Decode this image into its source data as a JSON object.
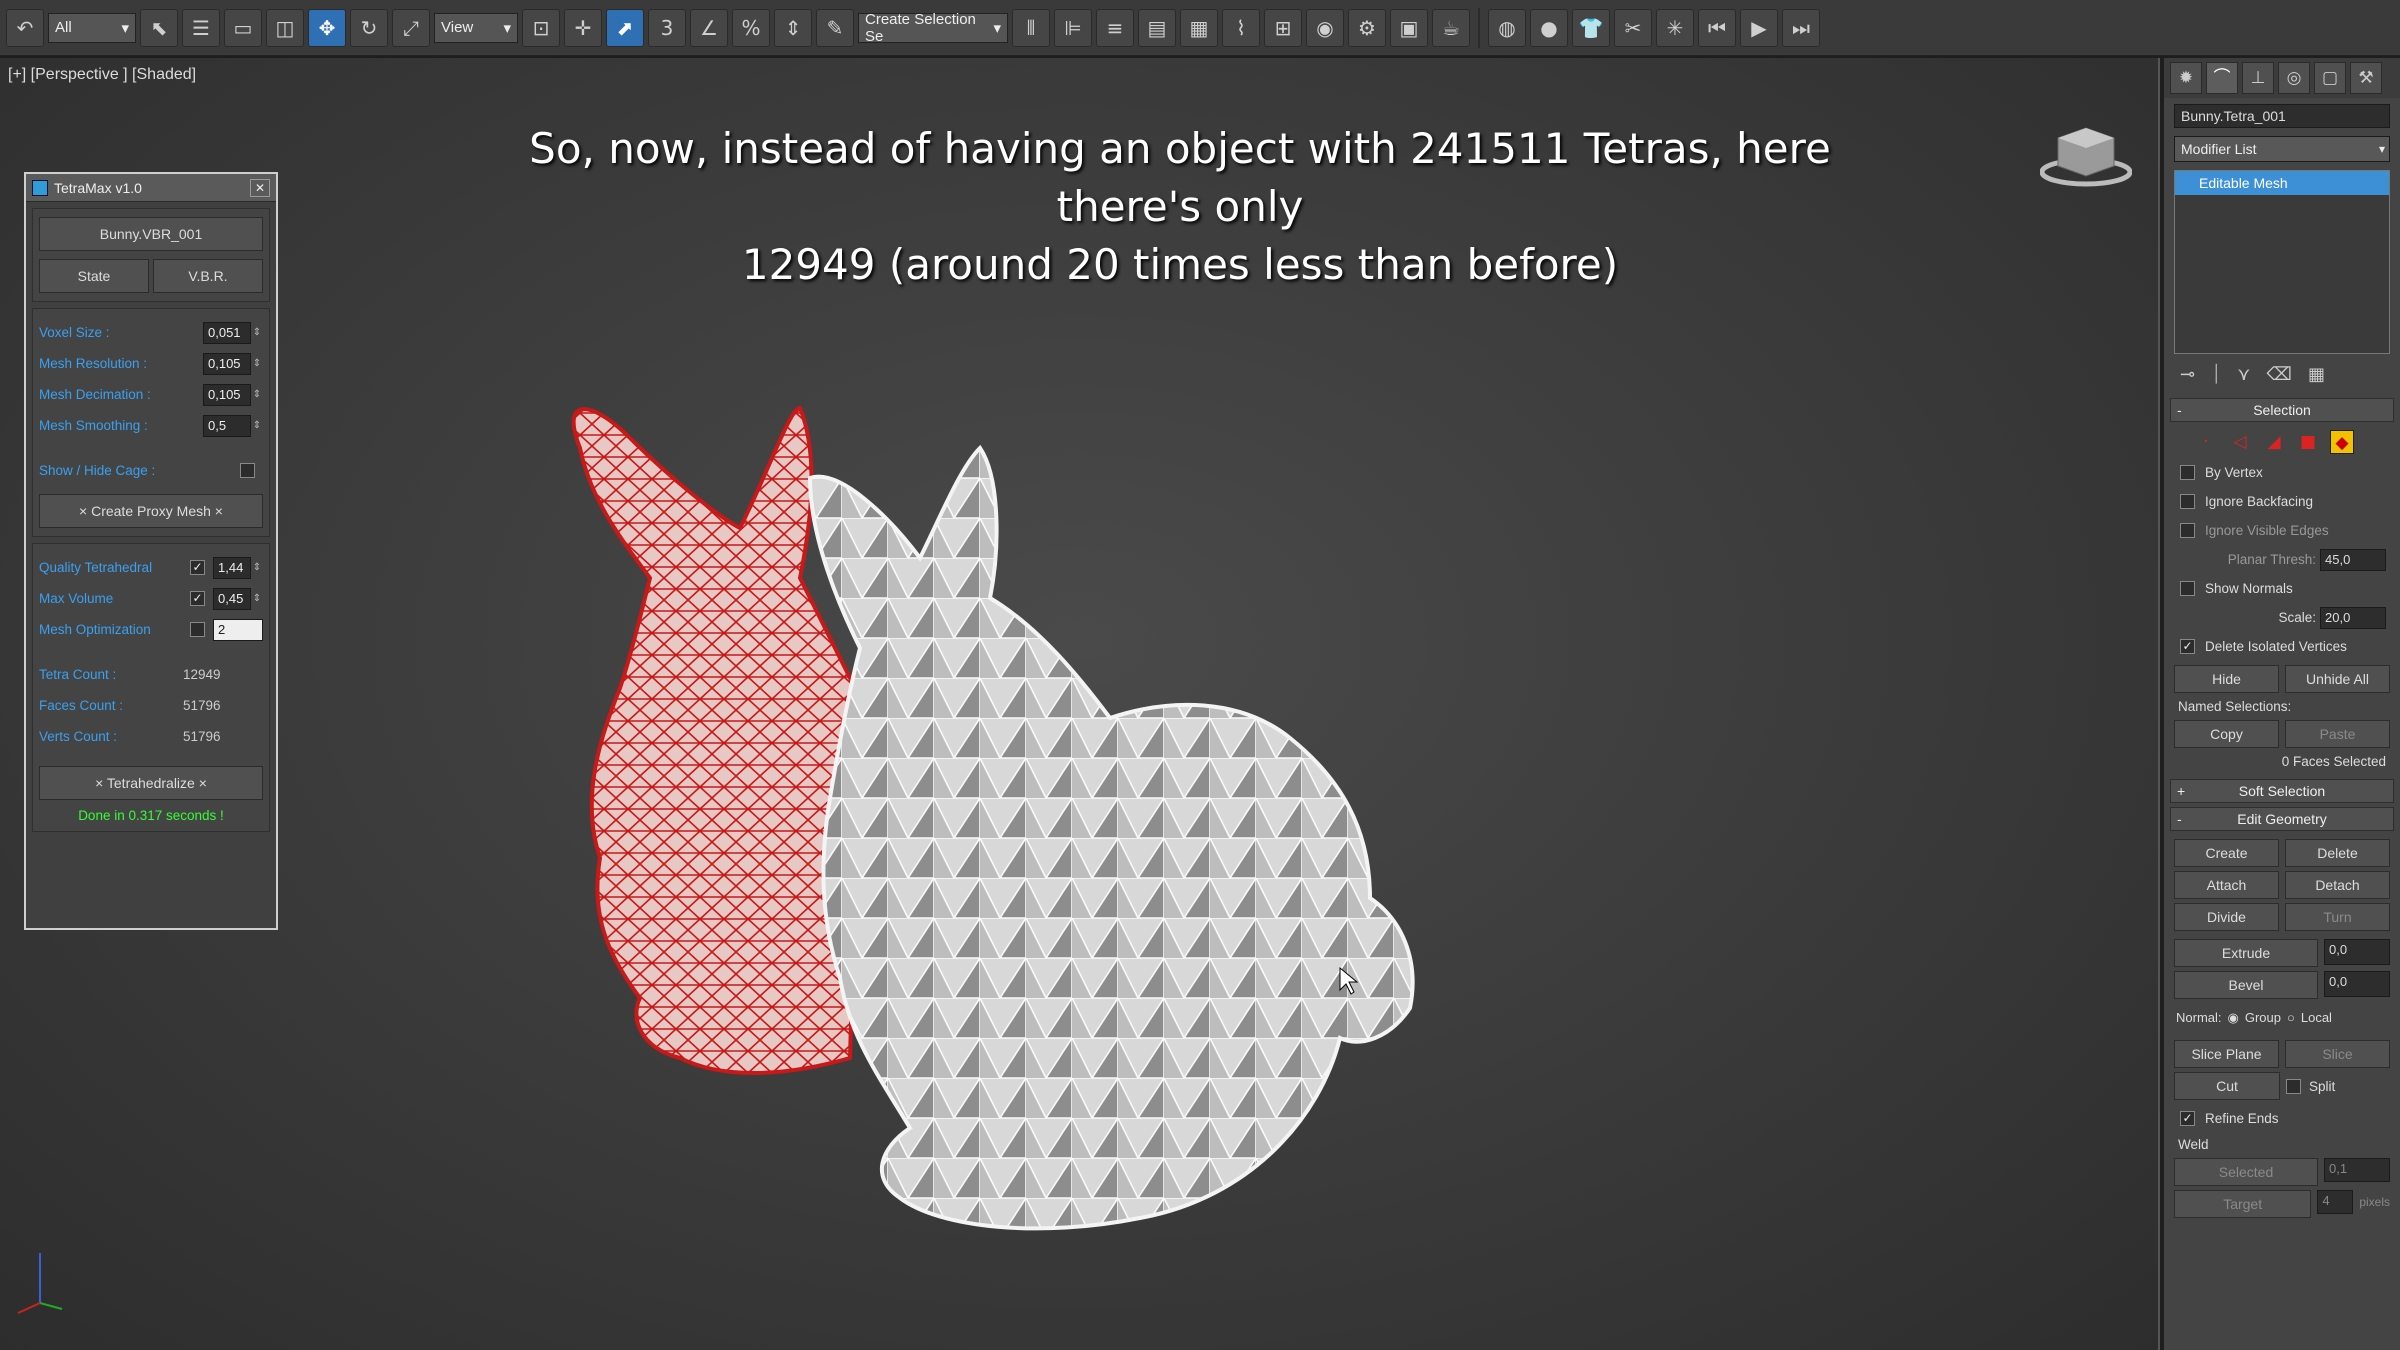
{
  "toolbar": {
    "selection_filter": "All",
    "ref_coord": "View",
    "named_selection_placeholder": "Create Selection Se"
  },
  "viewport": {
    "label": "[+] [Perspective ] [Shaded]",
    "caption_line1": "So, now, instead of having an object with 241511 Tetras, here there's only",
    "caption_line2": "12949 (around 20 times less than before)"
  },
  "tetramax": {
    "title": "TetraMax v1.0",
    "object_name": "Bunny.VBR_001",
    "state_label": "State",
    "vbr_label": "V.B.R.",
    "voxel_size_label": "Voxel Size :",
    "voxel_size": "0,051",
    "mesh_resolution_label": "Mesh Resolution :",
    "mesh_resolution": "0,105",
    "mesh_decimation_label": "Mesh Decimation :",
    "mesh_decimation": "0,105",
    "mesh_smoothing_label": "Mesh Smoothing :",
    "mesh_smoothing": "0,5",
    "show_hide_cage_label": "Show / Hide Cage :",
    "create_proxy_label": "× Create Proxy Mesh ×",
    "quality_label": "Quality Tetrahedral",
    "quality": "1,44",
    "max_volume_label": "Max Volume",
    "max_volume": "0,45",
    "mesh_opt_label": "Mesh Optimization",
    "mesh_opt": "2",
    "tetra_count_label": "Tetra Count :",
    "tetra_count": "12949",
    "faces_count_label": "Faces Count :",
    "faces_count": "51796",
    "verts_count_label": "Verts Count :",
    "verts_count": "51796",
    "tetrahedralize_label": "× Tetrahedralize ×",
    "done_text": "Done in 0.317 seconds !"
  },
  "command_panel": {
    "object_name": "Bunny.Tetra_001",
    "modifier_list": "Modifier List",
    "stack_item": "Editable Mesh",
    "selection_title": "Selection",
    "by_vertex": "By Vertex",
    "ignore_backfacing": "Ignore Backfacing",
    "ignore_visible_edges": "Ignore Visible Edges",
    "planar_thresh_label": "Planar Thresh:",
    "planar_thresh": "45,0",
    "show_normals": "Show Normals",
    "scale_label": "Scale:",
    "scale": "20,0",
    "delete_isolated": "Delete Isolated Vertices",
    "hide": "Hide",
    "unhide_all": "Unhide All",
    "named_selections": "Named Selections:",
    "copy": "Copy",
    "paste": "Paste",
    "faces_selected": "0 Faces Selected",
    "soft_selection": "Soft Selection",
    "edit_geometry": "Edit Geometry",
    "create": "Create",
    "delete": "Delete",
    "attach": "Attach",
    "detach": "Detach",
    "divide": "Divide",
    "turn": "Turn",
    "extrude": "Extrude",
    "extrude_val": "0,0",
    "bevel": "Bevel",
    "bevel_val": "0,0",
    "normal_label": "Normal:",
    "group": "Group",
    "local": "Local",
    "slice_plane": "Slice Plane",
    "slice": "Slice",
    "cut": "Cut",
    "split": "Split",
    "refine_ends": "Refine Ends",
    "weld": "Weld",
    "selected": "Selected",
    "selected_val": "0,1",
    "target": "Target",
    "target_val": "4",
    "pixels": "pixels"
  },
  "colors": {
    "accent_blue": "#3d8fd6",
    "label_blue": "#3aa0f0",
    "done_green": "#33ff33",
    "wire_red": "#d42020"
  }
}
